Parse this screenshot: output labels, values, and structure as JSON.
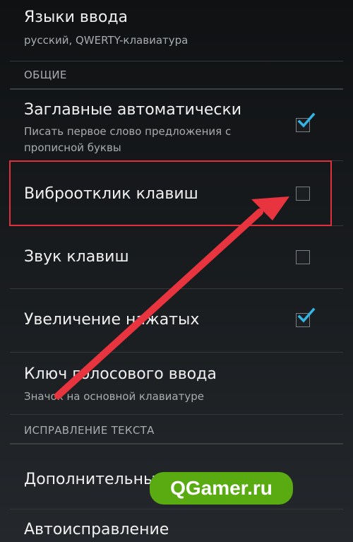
{
  "items": [
    {
      "title": "Языки ввода",
      "summary": "русский, QWERTY-клавиатура"
    },
    {
      "title": "Заглавные автоматически",
      "summary": "Писать первое слово предложения с прописной буквы",
      "checked": true
    },
    {
      "title": "Виброотклик клавиш",
      "checked": false
    },
    {
      "title": "Звук клавиш",
      "checked": false
    },
    {
      "title": "Увеличение нажатых",
      "checked": true
    },
    {
      "title": "Ключ голосового ввода",
      "summary": "Значок на основной клавиатуре"
    },
    {
      "title": "Дополнительные"
    },
    {
      "title": "Автоисправление"
    }
  ],
  "sections": {
    "general": "ОБЩИЕ",
    "text_correction": "ИСПРАВЛЕНИЕ ТЕКСТА"
  },
  "annotation": {
    "highlight_color": "#e0303b",
    "arrow_color": "#e8343f"
  },
  "watermark": {
    "text": "QGamer.ru",
    "color": "#5aab12"
  },
  "colors": {
    "check_accent": "#33b5e5"
  }
}
